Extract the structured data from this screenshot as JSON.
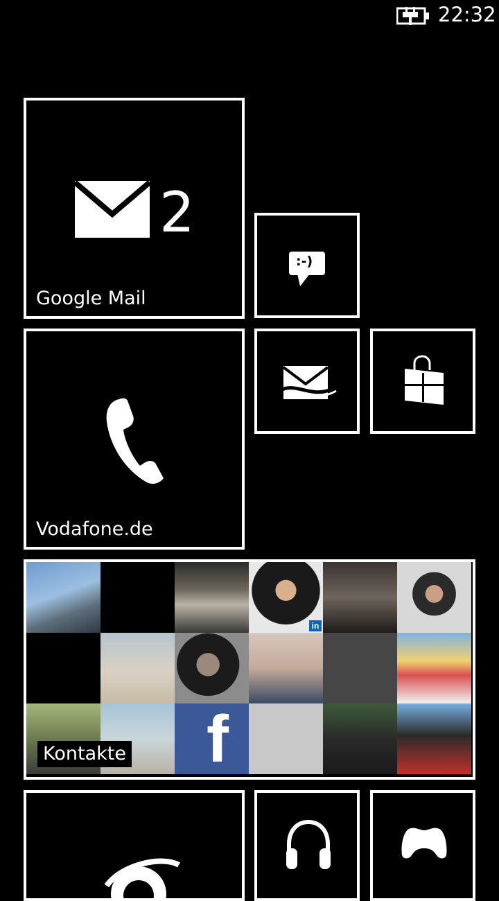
{
  "status_bar": {
    "time": "22:32",
    "battery_icon": "battery-charging-icon"
  },
  "tiles": {
    "google_mail": {
      "label": "Google Mail",
      "count": "2",
      "icon": "mail-icon"
    },
    "messaging": {
      "icon": "messaging-smiley-icon",
      "emoticon": ":-)"
    },
    "phone": {
      "label": "Vodafone.de",
      "icon": "phone-icon"
    },
    "outlook_mail": {
      "icon": "outlook-mail-icon"
    },
    "store": {
      "icon": "store-icon"
    },
    "contacts": {
      "label": "Kontakte",
      "icon": "people-photo-grid"
    },
    "internet_explorer": {
      "icon": "internet-explorer-icon"
    },
    "music": {
      "icon": "headphones-icon"
    },
    "games": {
      "icon": "game-controller-icon"
    }
  },
  "contacts_grid": {
    "cells": [
      "photo",
      "empty",
      "photo",
      "photo",
      "photo",
      "photo",
      "empty",
      "photo",
      "photo",
      "photo",
      "grey",
      "photo",
      "photo",
      "photo",
      "facebook",
      "light-grey",
      "photo",
      "photo"
    ],
    "badge": "in"
  },
  "colors": {
    "background": "#000000",
    "tile_border": "#ffffff",
    "text": "#ffffff",
    "facebook_blue": "#3b5998"
  }
}
